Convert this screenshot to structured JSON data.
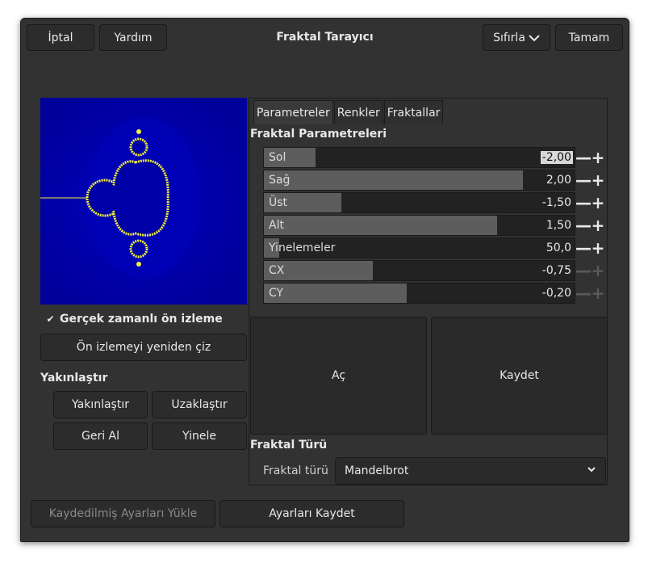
{
  "header": {
    "cancel_label": "İptal",
    "help_label": "Yardım",
    "title": "Fraktal Tarayıcı",
    "reset_label": "Sıfırla",
    "ok_label": "Tamam"
  },
  "preview": {
    "realtime_label": "Gerçek zamanlı ön izleme",
    "realtime_checked": true,
    "redraw_label": "Ön izlemeyi yeniden çiz"
  },
  "zoom": {
    "heading": "Yakınlaştır",
    "zoom_in_label": "Yakınlaştır",
    "zoom_out_label": "Uzaklaştır",
    "undo_label": "Geri Al",
    "redo_label": "Yinele"
  },
  "tabs": [
    "Parametreler",
    "Renkler",
    "Fraktallar"
  ],
  "params": {
    "heading": "Fraktal Parametreleri",
    "rows": [
      {
        "label": "Sol",
        "value": "-2,00",
        "fill": 0.165
      },
      {
        "label": "Sağ",
        "value": "2,00",
        "fill": 0.835
      },
      {
        "label": "Üst",
        "value": "-1,50",
        "fill": 0.25
      },
      {
        "label": "Alt",
        "value": "1,50",
        "fill": 0.75
      },
      {
        "label": "Yinelemeler",
        "value": "50,0",
        "fill": 0.05
      },
      {
        "label": "CX",
        "value": "-0,75",
        "fill": 0.35
      },
      {
        "label": "CY",
        "value": "-0,20",
        "fill": 0.46
      }
    ]
  },
  "actions": {
    "open_label": "Aç",
    "save_label": "Kaydet"
  },
  "fractal_type": {
    "heading": "Fraktal Türü",
    "label": "Fraktal türü",
    "value": "Mandelbrot"
  },
  "footer": {
    "load_label": "Kaydedilmiş Ayarları Yükle",
    "save_settings_label": "Ayarları Kaydet"
  },
  "colors": {
    "window_bg": "#323232",
    "fractal_bg": "#0000a8",
    "fractal_edge": "#f0f040"
  }
}
